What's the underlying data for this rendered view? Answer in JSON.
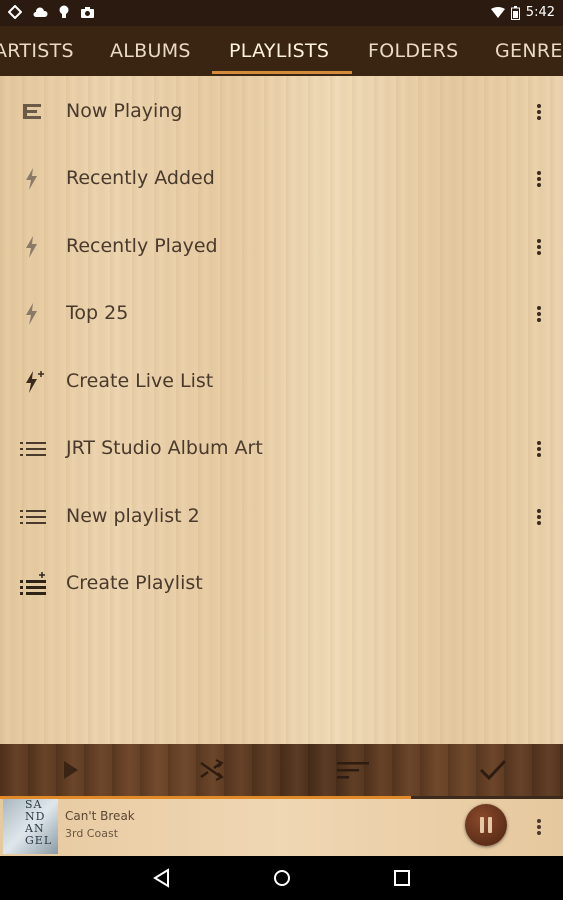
{
  "status": {
    "time": "5:42"
  },
  "tabs": [
    {
      "label": "ARTISTS"
    },
    {
      "label": "ALBUMS"
    },
    {
      "label": "PLAYLISTS"
    },
    {
      "label": "FOLDERS"
    },
    {
      "label": "GENRES"
    }
  ],
  "active_tab": "PLAYLISTS",
  "playlists": [
    {
      "label": "Now Playing",
      "icon": "queue-icon"
    },
    {
      "label": "Recently Added",
      "icon": "lightning-icon"
    },
    {
      "label": "Recently Played",
      "icon": "lightning-icon"
    },
    {
      "label": "Top 25",
      "icon": "lightning-icon"
    },
    {
      "label": "Create Live List",
      "icon": "lightning-plus-icon"
    },
    {
      "label": "JRT Studio Album Art",
      "icon": "list-icon"
    },
    {
      "label": "New playlist 2",
      "icon": "list-icon"
    },
    {
      "label": "Create Playlist",
      "icon": "list-plus-icon"
    }
  ],
  "now_playing": {
    "title": "Can't Break",
    "artist": "3rd Coast",
    "album_art_text": "SA\nND\nAN\nGEL",
    "progress": 0.73
  },
  "colors": {
    "accent": "#e08a2a",
    "tab_bg": "#3a2412"
  }
}
